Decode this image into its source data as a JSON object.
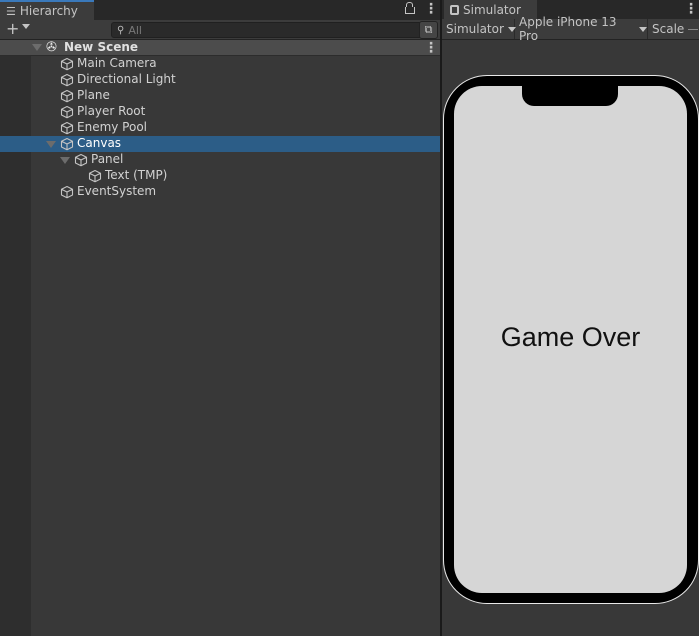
{
  "hierarchy": {
    "tab_label": "Hierarchy",
    "tab_icon": "list-icon",
    "add_label": "+",
    "search_placeholder": "All",
    "scene": {
      "name": "New Scene",
      "icon": "unity-logo-icon"
    },
    "items": [
      {
        "label": "Main Camera",
        "depth": 0,
        "expanded": null,
        "selected": false
      },
      {
        "label": "Directional Light",
        "depth": 0,
        "expanded": null,
        "selected": false
      },
      {
        "label": "Plane",
        "depth": 0,
        "expanded": null,
        "selected": false
      },
      {
        "label": "Player Root",
        "depth": 0,
        "expanded": null,
        "selected": false
      },
      {
        "label": "Enemy Pool",
        "depth": 0,
        "expanded": null,
        "selected": false
      },
      {
        "label": "Canvas",
        "depth": 0,
        "expanded": true,
        "selected": true
      },
      {
        "label": "Panel",
        "depth": 1,
        "expanded": true,
        "selected": false
      },
      {
        "label": "Text (TMP)",
        "depth": 2,
        "expanded": null,
        "selected": false
      },
      {
        "label": "EventSystem",
        "depth": 0,
        "expanded": null,
        "selected": false
      }
    ]
  },
  "simulator": {
    "tab_label": "Simulator",
    "tab_icon": "device-icon",
    "mode_dropdown": "Simulator",
    "device_dropdown": "Apple iPhone 13 Pro",
    "scale_label": "Scale",
    "screen_text": "Game Over"
  },
  "colors": {
    "selection": "#2c5d87",
    "panel_bg": "#383838",
    "screen_bg": "#d6d6d6"
  }
}
